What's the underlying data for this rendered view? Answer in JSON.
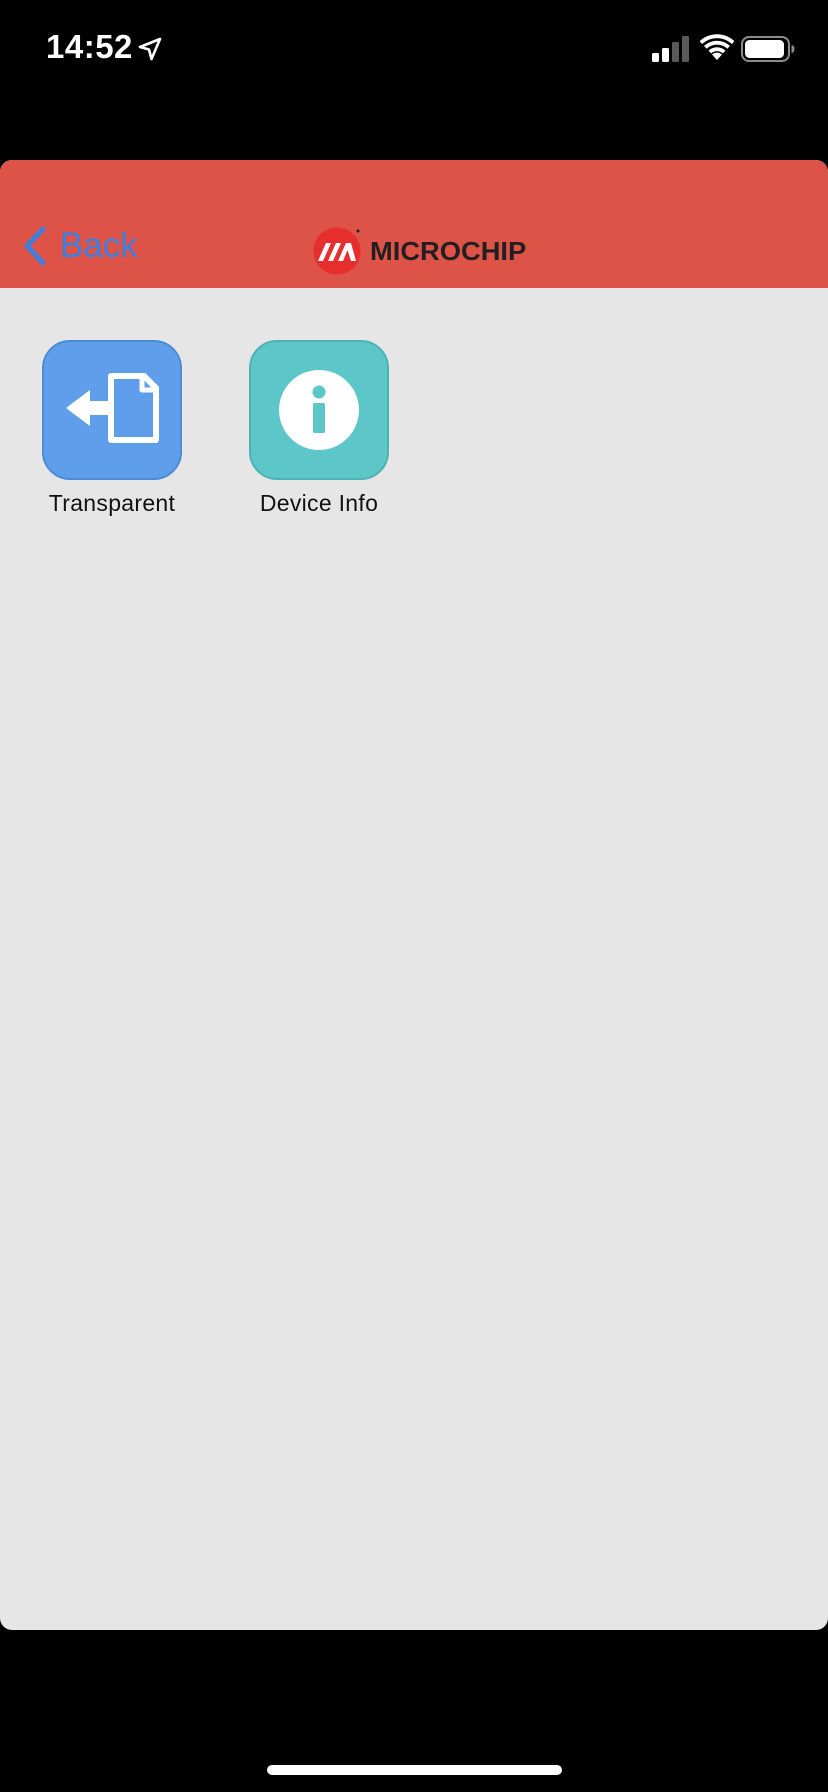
{
  "status_bar": {
    "time": "14:52",
    "icons": [
      "location-arrow-icon",
      "cellular-signal-icon",
      "wifi-icon",
      "battery-icon"
    ]
  },
  "nav_bar": {
    "back_label": "Back",
    "brand_name": "MICROCHIP",
    "colors": {
      "background": "#dd5347",
      "back_tint": "#3e7ede"
    }
  },
  "services": [
    {
      "label": "Transparent",
      "icon": "file-transfer-icon",
      "color": "#5e9eea"
    },
    {
      "label": "Device Info",
      "icon": "info-icon",
      "color": "#5cc6c8"
    }
  ]
}
